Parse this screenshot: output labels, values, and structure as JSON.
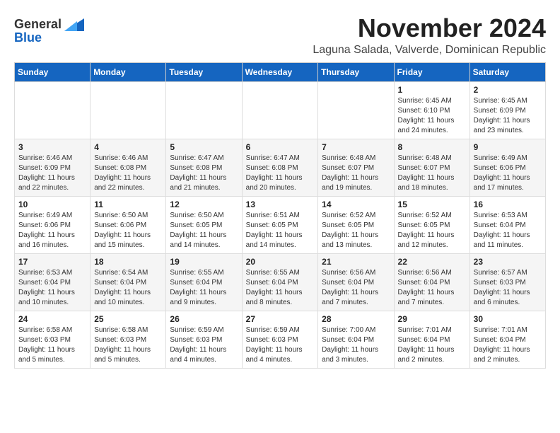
{
  "header": {
    "logo_general": "General",
    "logo_blue": "Blue",
    "month_title": "November 2024",
    "subtitle": "Laguna Salada, Valverde, Dominican Republic"
  },
  "columns": [
    "Sunday",
    "Monday",
    "Tuesday",
    "Wednesday",
    "Thursday",
    "Friday",
    "Saturday"
  ],
  "weeks": [
    {
      "days": [
        {
          "number": "",
          "detail": ""
        },
        {
          "number": "",
          "detail": ""
        },
        {
          "number": "",
          "detail": ""
        },
        {
          "number": "",
          "detail": ""
        },
        {
          "number": "",
          "detail": ""
        },
        {
          "number": "1",
          "detail": "Sunrise: 6:45 AM\nSunset: 6:10 PM\nDaylight: 11 hours\nand 24 minutes."
        },
        {
          "number": "2",
          "detail": "Sunrise: 6:45 AM\nSunset: 6:09 PM\nDaylight: 11 hours\nand 23 minutes."
        }
      ]
    },
    {
      "days": [
        {
          "number": "3",
          "detail": "Sunrise: 6:46 AM\nSunset: 6:09 PM\nDaylight: 11 hours\nand 22 minutes."
        },
        {
          "number": "4",
          "detail": "Sunrise: 6:46 AM\nSunset: 6:08 PM\nDaylight: 11 hours\nand 22 minutes."
        },
        {
          "number": "5",
          "detail": "Sunrise: 6:47 AM\nSunset: 6:08 PM\nDaylight: 11 hours\nand 21 minutes."
        },
        {
          "number": "6",
          "detail": "Sunrise: 6:47 AM\nSunset: 6:08 PM\nDaylight: 11 hours\nand 20 minutes."
        },
        {
          "number": "7",
          "detail": "Sunrise: 6:48 AM\nSunset: 6:07 PM\nDaylight: 11 hours\nand 19 minutes."
        },
        {
          "number": "8",
          "detail": "Sunrise: 6:48 AM\nSunset: 6:07 PM\nDaylight: 11 hours\nand 18 minutes."
        },
        {
          "number": "9",
          "detail": "Sunrise: 6:49 AM\nSunset: 6:06 PM\nDaylight: 11 hours\nand 17 minutes."
        }
      ]
    },
    {
      "days": [
        {
          "number": "10",
          "detail": "Sunrise: 6:49 AM\nSunset: 6:06 PM\nDaylight: 11 hours\nand 16 minutes."
        },
        {
          "number": "11",
          "detail": "Sunrise: 6:50 AM\nSunset: 6:06 PM\nDaylight: 11 hours\nand 15 minutes."
        },
        {
          "number": "12",
          "detail": "Sunrise: 6:50 AM\nSunset: 6:05 PM\nDaylight: 11 hours\nand 14 minutes."
        },
        {
          "number": "13",
          "detail": "Sunrise: 6:51 AM\nSunset: 6:05 PM\nDaylight: 11 hours\nand 14 minutes."
        },
        {
          "number": "14",
          "detail": "Sunrise: 6:52 AM\nSunset: 6:05 PM\nDaylight: 11 hours\nand 13 minutes."
        },
        {
          "number": "15",
          "detail": "Sunrise: 6:52 AM\nSunset: 6:05 PM\nDaylight: 11 hours\nand 12 minutes."
        },
        {
          "number": "16",
          "detail": "Sunrise: 6:53 AM\nSunset: 6:04 PM\nDaylight: 11 hours\nand 11 minutes."
        }
      ]
    },
    {
      "days": [
        {
          "number": "17",
          "detail": "Sunrise: 6:53 AM\nSunset: 6:04 PM\nDaylight: 11 hours\nand 10 minutes."
        },
        {
          "number": "18",
          "detail": "Sunrise: 6:54 AM\nSunset: 6:04 PM\nDaylight: 11 hours\nand 10 minutes."
        },
        {
          "number": "19",
          "detail": "Sunrise: 6:55 AM\nSunset: 6:04 PM\nDaylight: 11 hours\nand 9 minutes."
        },
        {
          "number": "20",
          "detail": "Sunrise: 6:55 AM\nSunset: 6:04 PM\nDaylight: 11 hours\nand 8 minutes."
        },
        {
          "number": "21",
          "detail": "Sunrise: 6:56 AM\nSunset: 6:04 PM\nDaylight: 11 hours\nand 7 minutes."
        },
        {
          "number": "22",
          "detail": "Sunrise: 6:56 AM\nSunset: 6:04 PM\nDaylight: 11 hours\nand 7 minutes."
        },
        {
          "number": "23",
          "detail": "Sunrise: 6:57 AM\nSunset: 6:03 PM\nDaylight: 11 hours\nand 6 minutes."
        }
      ]
    },
    {
      "days": [
        {
          "number": "24",
          "detail": "Sunrise: 6:58 AM\nSunset: 6:03 PM\nDaylight: 11 hours\nand 5 minutes."
        },
        {
          "number": "25",
          "detail": "Sunrise: 6:58 AM\nSunset: 6:03 PM\nDaylight: 11 hours\nand 5 minutes."
        },
        {
          "number": "26",
          "detail": "Sunrise: 6:59 AM\nSunset: 6:03 PM\nDaylight: 11 hours\nand 4 minutes."
        },
        {
          "number": "27",
          "detail": "Sunrise: 6:59 AM\nSunset: 6:03 PM\nDaylight: 11 hours\nand 4 minutes."
        },
        {
          "number": "28",
          "detail": "Sunrise: 7:00 AM\nSunset: 6:04 PM\nDaylight: 11 hours\nand 3 minutes."
        },
        {
          "number": "29",
          "detail": "Sunrise: 7:01 AM\nSunset: 6:04 PM\nDaylight: 11 hours\nand 2 minutes."
        },
        {
          "number": "30",
          "detail": "Sunrise: 7:01 AM\nSunset: 6:04 PM\nDaylight: 11 hours\nand 2 minutes."
        }
      ]
    }
  ]
}
